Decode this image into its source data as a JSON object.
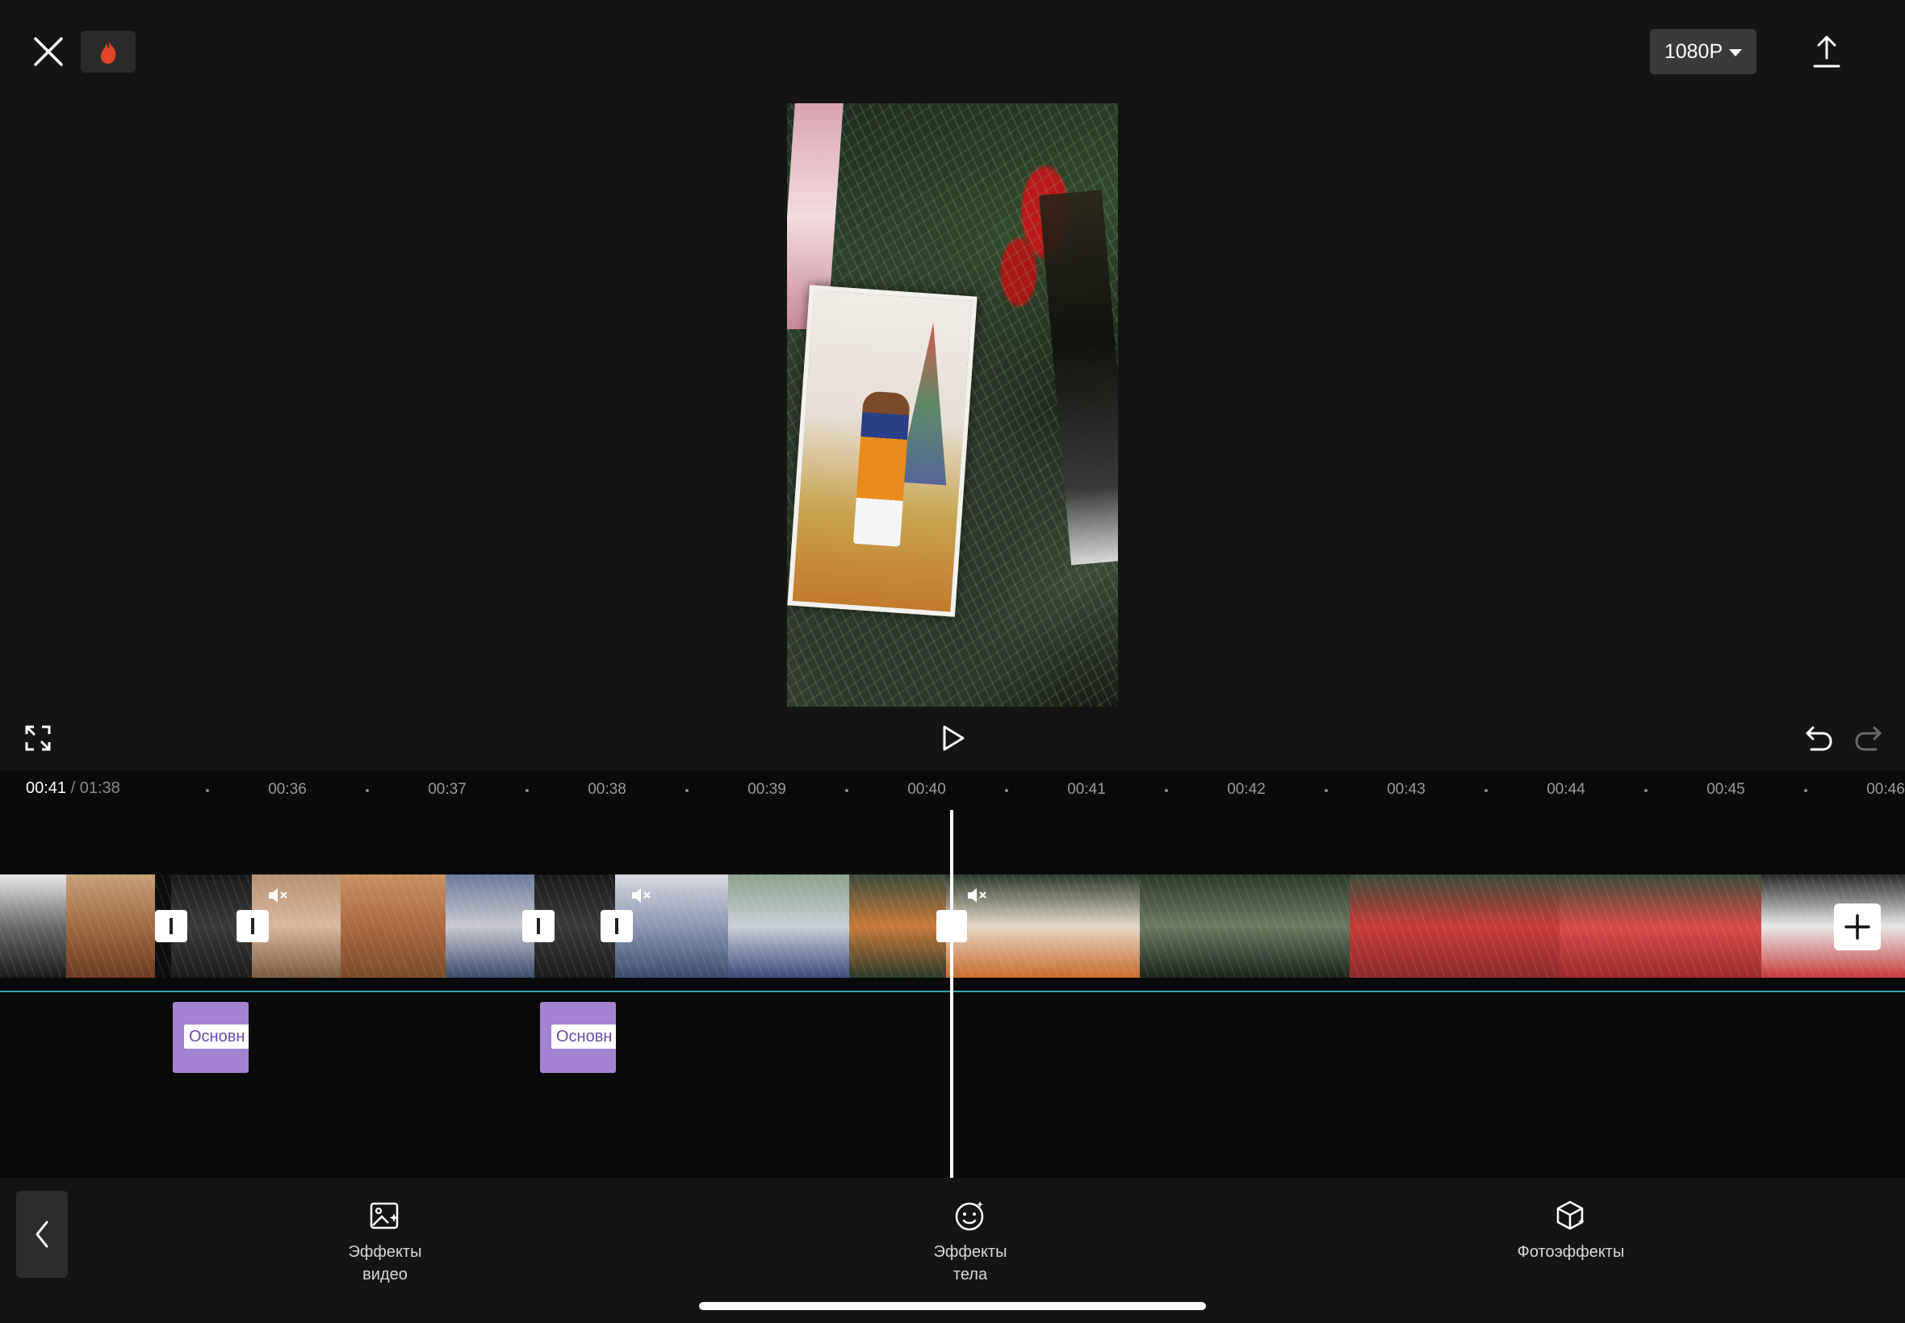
{
  "topbar": {
    "resolution_label": "1080P",
    "close_icon": "close-icon",
    "flame_icon": "flame-icon",
    "export_icon": "export-upload-icon",
    "flame_color": "#e0442a"
  },
  "preview": {
    "description_icon": "video-preview-frame"
  },
  "controls": {
    "fullscreen_icon": "fullscreen-icon",
    "play_icon": "play-icon",
    "undo_icon": "undo-icon",
    "redo_icon": "redo-icon"
  },
  "timeline": {
    "current_time": "00:41",
    "separator": "/",
    "total_time": "01:38",
    "ticks": [
      "00:36",
      "00:37",
      "00:38",
      "00:39",
      "00:40",
      "00:41",
      "00:42",
      "00:43",
      "00:44",
      "00:45",
      "00:46"
    ],
    "effect_clips": [
      {
        "label": "Основн"
      },
      {
        "label": "Основн"
      }
    ],
    "track_accent": "#3aa6b4",
    "effect_color": "#a383d0"
  },
  "toolbar": {
    "items": [
      {
        "label_line1": "Эффекты",
        "label_line2": "видео",
        "icon": "video-effects-icon"
      },
      {
        "label_line1": "Эффекты",
        "label_line2": "тела",
        "icon": "body-effects-icon"
      },
      {
        "label_line1": "Фотоэффекты",
        "label_line2": "",
        "icon": "photo-effects-icon"
      }
    ]
  }
}
